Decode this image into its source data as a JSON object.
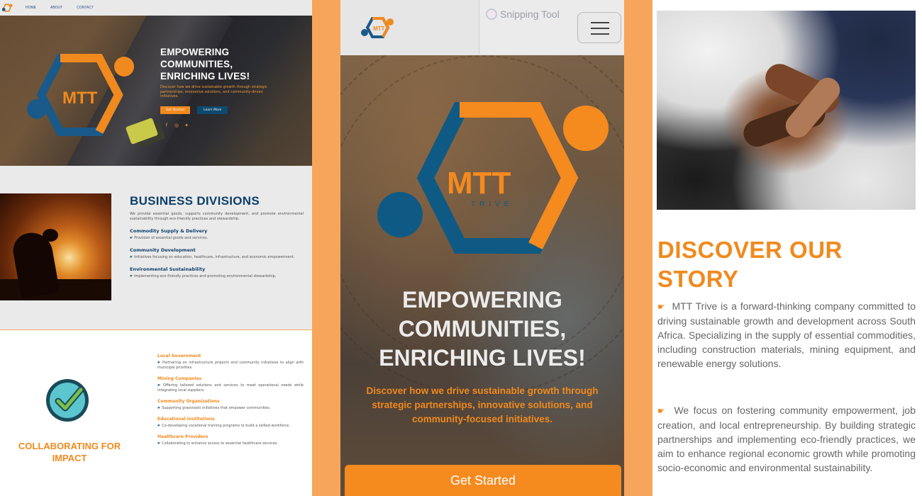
{
  "desktop": {
    "nav": {
      "items": [
        "HOME",
        "ABOUT",
        "CONTACT"
      ]
    },
    "hero": {
      "title": "EMPOWERING COMMUNITIES, ENRICHING LIVES!",
      "subtitle": "Discover how we drive sustainable growth through strategic partnerships, innovative solutions, and community-driven initiatives.",
      "primary_button": "Get Started",
      "secondary_button": "Learn More",
      "social_icons": [
        "facebook-icon",
        "instagram-icon",
        "twitter-icon"
      ]
    },
    "divisions": {
      "title": "BUSINESS DIVISIONS",
      "intro": "We provide essential goods, supports community development, and promote environmental sustainability through eco-friendly practices and stewardship.",
      "items": [
        {
          "heading": "Commodity Supply & Delivery",
          "text": "Provision of essential goods and services."
        },
        {
          "heading": "Community Development",
          "text": "Initiatives focusing on education, healthcare, infrastructure, and economic empowerment."
        },
        {
          "heading": "Environmental Sustainability",
          "text": "Implementing eco-friendly practices and promoting environmental stewardship."
        }
      ]
    },
    "collab": {
      "title": "COLLABORATING FOR IMPACT",
      "items": [
        {
          "heading": "Local Government",
          "text": "Partnering on infrastructure projects and community initiatives to align with municipal priorities."
        },
        {
          "heading": "Mining Companies",
          "text": "Offering tailored solutions and services to meet operational needs while integrating local suppliers."
        },
        {
          "heading": "Community Organizations",
          "text": "Supporting grassroots initiatives that empower communities."
        },
        {
          "heading": "Educational Institutions",
          "text": "Co-developing vocational training programs to build a skilled workforce."
        },
        {
          "heading": "Healthcare Providers",
          "text": "Collaborating to enhance access to essential healthcare services."
        }
      ]
    }
  },
  "mobile": {
    "overlay_label": "Snipping Tool",
    "logo_text": "MTT",
    "logo_subtext": "TRIVE",
    "hero": {
      "title": "EMPOWERING COMMUNITIES, ENRICHING LIVES!",
      "subtitle": "Discover how we drive sustainable growth through strategic partnerships, innovative solutions, and community-focused initiatives.",
      "cta": "Get Started"
    }
  },
  "about": {
    "title": "DISCOVER OUR STORY",
    "paragraph1": "MTT Trive is a forward-thinking company committed to driving sustainable growth and development across South Africa. Specializing in the supply of essential commodities, including construction materials, mining equipment, and renewable energy solutions.",
    "paragraph2": "We focus on fostering community empowerment, job creation, and local entrepreneurship. By building strategic partnerships and implementing eco-friendly practices, we aim to enhance regional economic growth while promoting socio-economic and environmental sustainability."
  },
  "colors": {
    "orange": "#f08a1e",
    "navy": "#0d3f6a",
    "teal_blue": "#1a5a8a",
    "background_peach": "#f7a55a"
  }
}
